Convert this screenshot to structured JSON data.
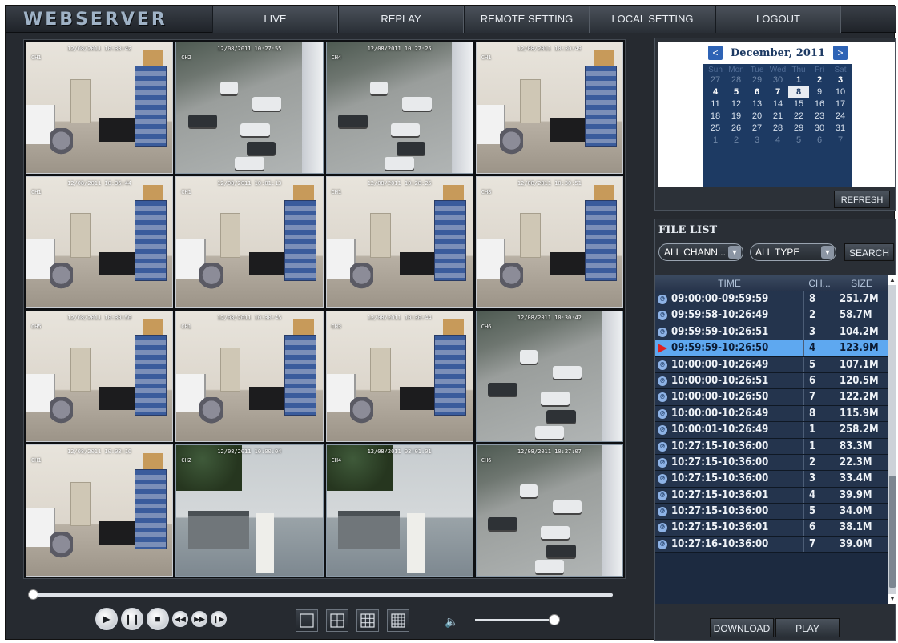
{
  "app": {
    "logo": "WEBSERVER"
  },
  "nav": [
    "LIVE",
    "REPLAY",
    "REMOTE SETTING",
    "LOCAL SETTING",
    "LOGOUT"
  ],
  "cameras": [
    {
      "ts": "12/08/2011 10:33:42",
      "ch": "CH1",
      "scene": "office"
    },
    {
      "ts": "12/08/2011 10:27:55",
      "ch": "CH2",
      "scene": "road"
    },
    {
      "ts": "12/08/2011 10:27:25",
      "ch": "CH4",
      "scene": "road"
    },
    {
      "ts": "12/08/2011 10:30:49",
      "ch": "CH1",
      "scene": "office"
    },
    {
      "ts": "12/08/2011 10:36:44",
      "ch": "CH1",
      "scene": "office"
    },
    {
      "ts": "12/08/2011 10:01:13",
      "ch": "CH1",
      "scene": "office"
    },
    {
      "ts": "12/08/2011 10:28:25",
      "ch": "CH1",
      "scene": "office"
    },
    {
      "ts": "12/08/2011 10:30:51",
      "ch": "CH8",
      "scene": "office"
    },
    {
      "ts": "12/08/2011 10:30:50",
      "ch": "CH5",
      "scene": "office"
    },
    {
      "ts": "12/08/2011 10:30:45",
      "ch": "CH1",
      "scene": "office"
    },
    {
      "ts": "12/08/2011 10:30:44",
      "ch": "CH3",
      "scene": "office"
    },
    {
      "ts": "12/08/2011 10:30:42",
      "ch": "CH6",
      "scene": "road"
    },
    {
      "ts": "12/08/2011 10:03:16",
      "ch": "CH1",
      "scene": "office"
    },
    {
      "ts": "12/08/2011 10:00:04",
      "ch": "CH2",
      "scene": "roof"
    },
    {
      "ts": "12/08/2011 03:01:01",
      "ch": "CH4",
      "scene": "roof"
    },
    {
      "ts": "12/08/2011 10:27:07",
      "ch": "CH6",
      "scene": "road"
    }
  ],
  "playback": {
    "progress": 0.0,
    "volume": 0.92
  },
  "controls": [
    "play",
    "pause",
    "stop",
    "slow",
    "fast",
    "step"
  ],
  "layouts": [
    "1x1",
    "2x2",
    "3x3",
    "4x4"
  ],
  "calendar": {
    "title": "December, 2011",
    "prev": "<",
    "next": ">",
    "weekdays": [
      "Sun",
      "Mon",
      "Tue",
      "Wed",
      "Thu",
      "Fri",
      "Sat"
    ],
    "weeks": [
      [
        "27",
        "28",
        "29",
        "30",
        "1",
        "2",
        "3"
      ],
      [
        "4",
        "5",
        "6",
        "7",
        "8",
        "9",
        "10"
      ],
      [
        "11",
        "12",
        "13",
        "14",
        "15",
        "16",
        "17"
      ],
      [
        "18",
        "19",
        "20",
        "21",
        "22",
        "23",
        "24"
      ],
      [
        "25",
        "26",
        "27",
        "28",
        "29",
        "30",
        "31"
      ],
      [
        "1",
        "2",
        "3",
        "4",
        "5",
        "6",
        "7"
      ]
    ],
    "selected_day": "8",
    "refresh_label": "REFRESH"
  },
  "file_list": {
    "title": "FILE LIST",
    "channel_select": "ALL CHANN...",
    "type_select": "ALL TYPE",
    "search_label": "SEARCH",
    "headers": {
      "time": "TIME",
      "ch": "CH...",
      "size": "SIZE"
    },
    "rows": [
      {
        "time": "09:00:00-09:59:59",
        "ch": "8",
        "size": "251.7M"
      },
      {
        "time": "09:59:58-10:26:49",
        "ch": "2",
        "size": "58.7M"
      },
      {
        "time": "09:59:59-10:26:51",
        "ch": "3",
        "size": "104.2M"
      },
      {
        "time": "09:59:59-10:26:50",
        "ch": "4",
        "size": "123.9M",
        "selected": true
      },
      {
        "time": "10:00:00-10:26:49",
        "ch": "5",
        "size": "107.1M"
      },
      {
        "time": "10:00:00-10:26:51",
        "ch": "6",
        "size": "120.5M"
      },
      {
        "time": "10:00:00-10:26:50",
        "ch": "7",
        "size": "122.2M"
      },
      {
        "time": "10:00:00-10:26:49",
        "ch": "8",
        "size": "115.9M"
      },
      {
        "time": "10:00:01-10:26:49",
        "ch": "1",
        "size": "258.2M"
      },
      {
        "time": "10:27:15-10:36:00",
        "ch": "1",
        "size": "83.3M"
      },
      {
        "time": "10:27:15-10:36:00",
        "ch": "2",
        "size": "22.3M"
      },
      {
        "time": "10:27:15-10:36:00",
        "ch": "3",
        "size": "33.4M"
      },
      {
        "time": "10:27:15-10:36:01",
        "ch": "4",
        "size": "39.9M"
      },
      {
        "time": "10:27:15-10:36:00",
        "ch": "5",
        "size": "34.0M"
      },
      {
        "time": "10:27:15-10:36:01",
        "ch": "6",
        "size": "38.1M"
      },
      {
        "time": "10:27:16-10:36:00",
        "ch": "7",
        "size": "39.0M"
      }
    ],
    "download_label": "DOWNLOAD",
    "play_label": "PLAY"
  }
}
